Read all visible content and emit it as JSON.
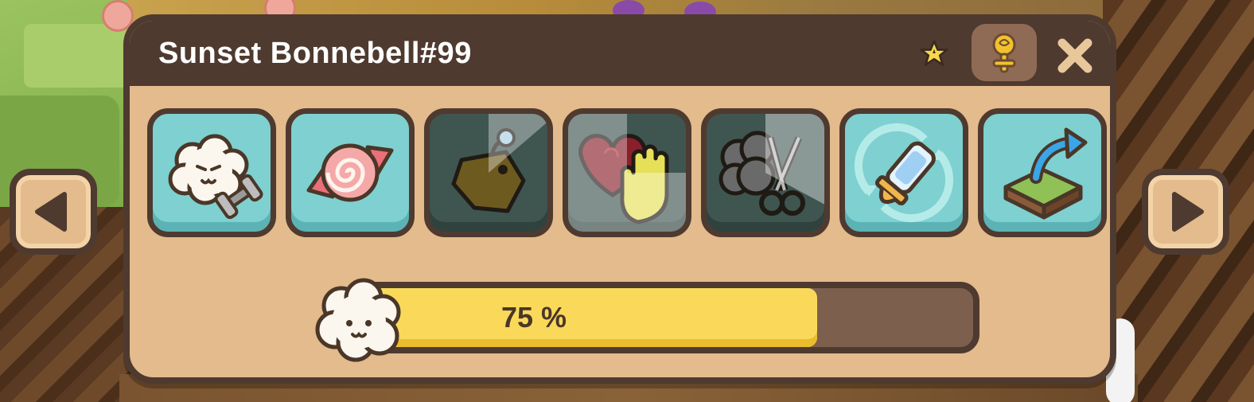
{
  "pet": {
    "name": "Sunset Bonnebell#99"
  },
  "header": {
    "icons": [
      "star-icon",
      "gender-female-icon",
      "close-icon"
    ]
  },
  "actions": [
    {
      "name": "train-button",
      "icon": "sheep-dumbbell-icon",
      "state": "ready"
    },
    {
      "name": "treat-button",
      "icon": "candy-icon",
      "state": "ready"
    },
    {
      "name": "wear-button",
      "icon": "gem-bag-icon",
      "state": "cooldown",
      "cooldown": 0.25
    },
    {
      "name": "pet-button",
      "icon": "heart-hand-icon",
      "state": "cooldown",
      "cooldown": 0.75
    },
    {
      "name": "shear-button",
      "icon": "wool-scissors-icon",
      "state": "cooldown",
      "cooldown": 0.3
    },
    {
      "name": "feed-button",
      "icon": "bottle-refresh-icon",
      "state": "ready"
    },
    {
      "name": "move-button",
      "icon": "tile-arrow-icon",
      "state": "ready"
    }
  ],
  "progress": {
    "value": 0.75,
    "label": "75 %"
  },
  "colors": {
    "panel": "#e3bb8c",
    "frame": "#4f3a30",
    "button": "#7fd0d0",
    "fill": "#fad95a"
  }
}
